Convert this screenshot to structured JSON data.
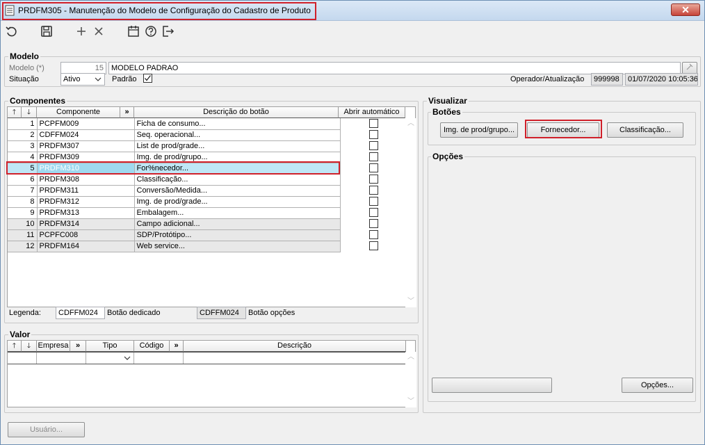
{
  "window": {
    "title": "PRDFM305 - Manutenção do Modelo de Configuração do Cadastro de Produto",
    "close_label": "✕"
  },
  "toolbar": {
    "buttons": [
      "refresh-icon",
      "save-icon",
      "add-icon",
      "delete-icon",
      "calendar-icon",
      "help-icon",
      "exit-icon"
    ]
  },
  "modelo": {
    "section_label": "Modelo",
    "modelo_label": "Modelo (*)",
    "modelo_code": "15",
    "modelo_name": "MODELO PADRAO",
    "situacao_label": "Situação",
    "situacao_value": "Ativo",
    "padrao_label": "Padrão",
    "padrao_checked": true,
    "operador_label": "Operador/Atualização",
    "operador_value": "999998",
    "atualizacao_value": "01/07/2020 10:05:36"
  },
  "componentes": {
    "section_label": "Componentes",
    "headers": {
      "up": "🡑",
      "down": "🡓",
      "componente": "Componente",
      "more": "»",
      "descricao": "Descrição do botão",
      "abrir": "Abrir automático"
    },
    "rows": [
      {
        "num": "1",
        "comp": "PCPFM009",
        "desc": "Ficha de consumo..."
      },
      {
        "num": "2",
        "comp": "CDFFM024",
        "desc": "Seq. operacional..."
      },
      {
        "num": "3",
        "comp": "PRDFM307",
        "desc": "List de prod/grade..."
      },
      {
        "num": "4",
        "comp": "PRDFM309",
        "desc": "Img. de prod/grupo..."
      },
      {
        "num": "5",
        "comp": "PRDFM310",
        "desc": "For%necedor..."
      },
      {
        "num": "6",
        "comp": "PRDFM308",
        "desc": "Classificação..."
      },
      {
        "num": "7",
        "comp": "PRDFM311",
        "desc": "Conversão/Medida..."
      },
      {
        "num": "8",
        "comp": "PRDFM312",
        "desc": "Img. de prod/grade..."
      },
      {
        "num": "9",
        "comp": "PRDFM313",
        "desc": "Embalagem..."
      },
      {
        "num": "10",
        "comp": "PRDFM314",
        "desc": "Campo adicional..."
      },
      {
        "num": "11",
        "comp": "PCPFC008",
        "desc": "SDP/Protótipo..."
      },
      {
        "num": "12",
        "comp": "PRDFM164",
        "desc": "Web service..."
      }
    ],
    "legenda_label": "Legenda:",
    "legenda_1_value": "CDFFM024",
    "legenda_1_text": "Botão dedicado",
    "legenda_2_value": "CDFFM024",
    "legenda_2_text": "Botão opções"
  },
  "valor": {
    "section_label": "Valor",
    "headers": {
      "up": "🡑",
      "down": "🡓",
      "empresa": "Empresa",
      "more1": "»",
      "tipo": "Tipo",
      "codigo": "Código",
      "more2": "»",
      "descricao": "Descrição"
    }
  },
  "visualizar": {
    "section_label": "Visualizar",
    "botoes_label": "Botões",
    "btn_img": "Img. de prod/grupo...",
    "btn_fornecedor": "Fornecedor...",
    "btn_classificacao": "Classificação...",
    "opcoes_label": "Opções",
    "btn_opcoes": "Opções..."
  },
  "footer": {
    "usuario_label": "Usuário..."
  }
}
